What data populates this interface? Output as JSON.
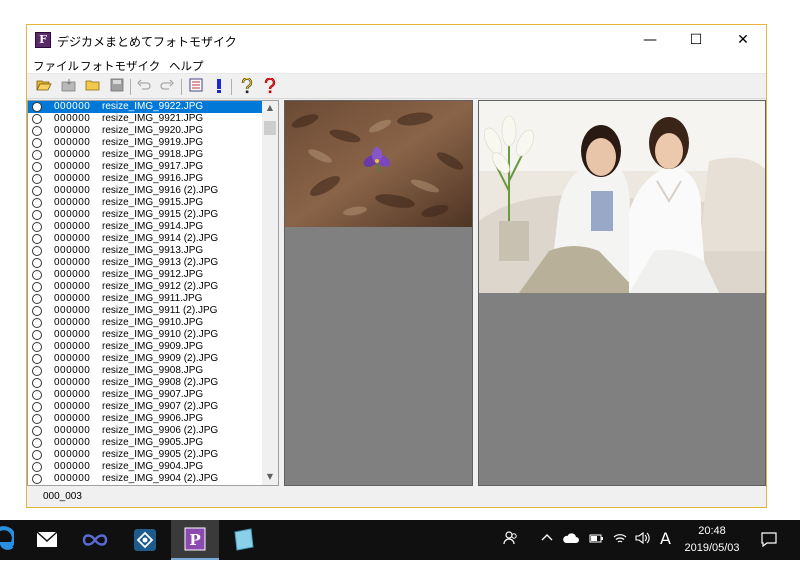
{
  "window": {
    "title": "デジカメまとめてフォトモザイク",
    "app_icon_letter": "F",
    "minimize": "—",
    "maximize": "☐",
    "close": "✕"
  },
  "menu": [
    "ファイル",
    "フォトモザイク",
    "ヘルプ"
  ],
  "toolbar": [
    "open-folder-icon",
    "import-icon",
    "folder-icon",
    "save-icon",
    "undo-icon",
    "redo-icon",
    "list-icon",
    "exclamation-icon",
    "help-icon",
    "help-red-icon"
  ],
  "file_list": {
    "selected_index": 0,
    "items": [
      {
        "code": "000000",
        "name": "resize_IMG_9922.JPG"
      },
      {
        "code": "000000",
        "name": "resize_IMG_9921.JPG"
      },
      {
        "code": "000000",
        "name": "resize_IMG_9920.JPG"
      },
      {
        "code": "000000",
        "name": "resize_IMG_9919.JPG"
      },
      {
        "code": "000000",
        "name": "resize_IMG_9918.JPG"
      },
      {
        "code": "000000",
        "name": "resize_IMG_9917.JPG"
      },
      {
        "code": "000000",
        "name": "resize_IMG_9916.JPG"
      },
      {
        "code": "000000",
        "name": "resize_IMG_9916 (2).JPG"
      },
      {
        "code": "000000",
        "name": "resize_IMG_9915.JPG"
      },
      {
        "code": "000000",
        "name": "resize_IMG_9915 (2).JPG"
      },
      {
        "code": "000000",
        "name": "resize_IMG_9914.JPG"
      },
      {
        "code": "000000",
        "name": "resize_IMG_9914 (2).JPG"
      },
      {
        "code": "000000",
        "name": "resize_IMG_9913.JPG"
      },
      {
        "code": "000000",
        "name": "resize_IMG_9913 (2).JPG"
      },
      {
        "code": "000000",
        "name": "resize_IMG_9912.JPG"
      },
      {
        "code": "000000",
        "name": "resize_IMG_9912 (2).JPG"
      },
      {
        "code": "000000",
        "name": "resize_IMG_9911.JPG"
      },
      {
        "code": "000000",
        "name": "resize_IMG_9911 (2).JPG"
      },
      {
        "code": "000000",
        "name": "resize_IMG_9910.JPG"
      },
      {
        "code": "000000",
        "name": "resize_IMG_9910 (2).JPG"
      },
      {
        "code": "000000",
        "name": "resize_IMG_9909.JPG"
      },
      {
        "code": "000000",
        "name": "resize_IMG_9909 (2).JPG"
      },
      {
        "code": "000000",
        "name": "resize_IMG_9908.JPG"
      },
      {
        "code": "000000",
        "name": "resize_IMG_9908 (2).JPG"
      },
      {
        "code": "000000",
        "name": "resize_IMG_9907.JPG"
      },
      {
        "code": "000000",
        "name": "resize_IMG_9907 (2).JPG"
      },
      {
        "code": "000000",
        "name": "resize_IMG_9906.JPG"
      },
      {
        "code": "000000",
        "name": "resize_IMG_9906 (2).JPG"
      },
      {
        "code": "000000",
        "name": "resize_IMG_9905.JPG"
      },
      {
        "code": "000000",
        "name": "resize_IMG_9905 (2).JPG"
      },
      {
        "code": "000000",
        "name": "resize_IMG_9904.JPG"
      },
      {
        "code": "000000",
        "name": "resize_IMG_9904 (2).JPG"
      }
    ]
  },
  "status": {
    "text": "000_003"
  },
  "taskbar": {
    "apps": [
      "edge-icon",
      "mail-icon",
      "infinity-app-icon",
      "network-app-icon",
      "photomosaic-app-icon",
      "notepad-app-icon"
    ],
    "active_app_letter": "P",
    "tray_ime": "A",
    "time": "20:48",
    "date": "2019/05/03"
  },
  "colors": {
    "window_border": "#e3b53c",
    "selection": "#0078d7",
    "pane_bg": "#808080",
    "taskbar_bg": "#101010"
  }
}
